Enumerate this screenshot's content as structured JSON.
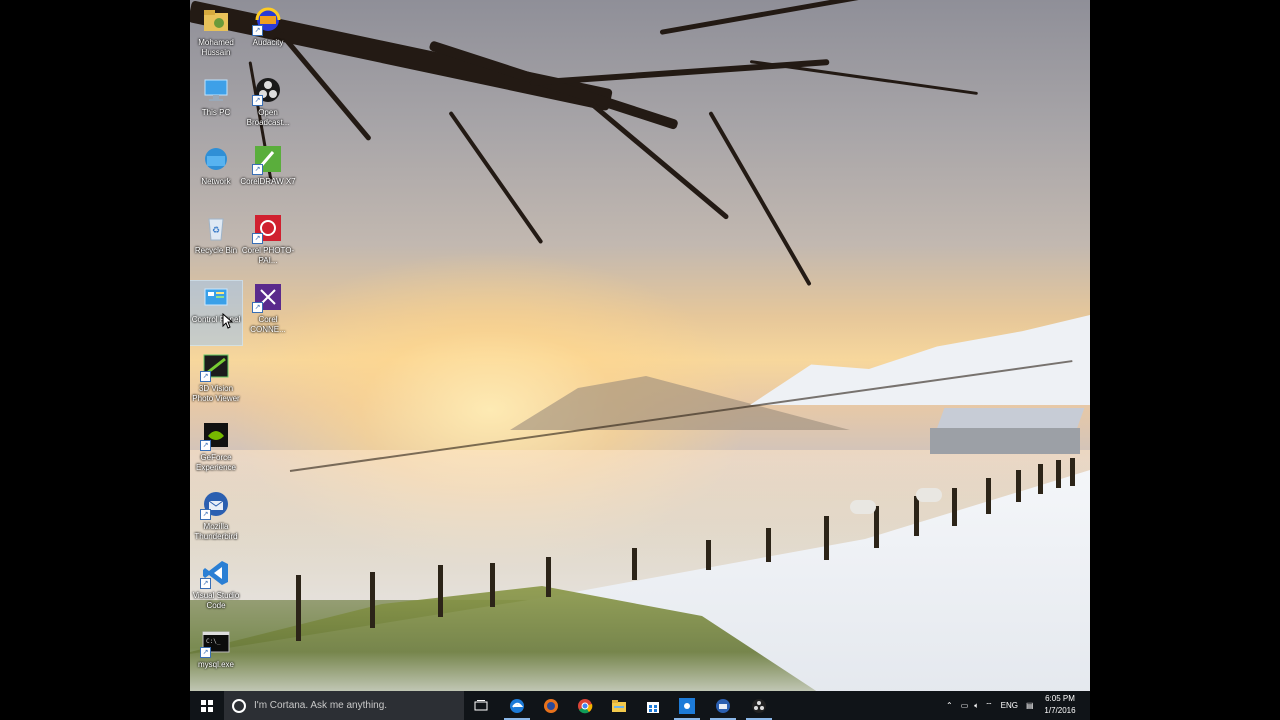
{
  "desktop": {
    "icons_col1": [
      {
        "label": "Mohamed Hussain",
        "icon": "user-folder-icon"
      },
      {
        "label": "This PC",
        "icon": "computer-icon"
      },
      {
        "label": "Network",
        "icon": "network-icon"
      },
      {
        "label": "Recycle Bin",
        "icon": "recycle-bin-icon"
      },
      {
        "label": "Control Panel",
        "icon": "control-panel-icon",
        "selected": true
      },
      {
        "label": "3D Vision Photo Viewer",
        "icon": "3d-vision-icon"
      },
      {
        "label": "GeForce Experience",
        "icon": "geforce-icon"
      },
      {
        "label": "Mozilla Thunderbird",
        "icon": "thunderbird-icon"
      },
      {
        "label": "Visual Studio Code",
        "icon": "vscode-icon"
      },
      {
        "label": "mysql.exe",
        "icon": "console-icon"
      }
    ],
    "icons_col2": [
      {
        "label": "Audacity",
        "icon": "audacity-icon"
      },
      {
        "label": "Open Broadcast...",
        "icon": "obs-icon"
      },
      {
        "label": "CorelDRAW X7",
        "icon": "coreldraw-icon"
      },
      {
        "label": "Corel PHOTO-PAI...",
        "icon": "corel-photopaint-icon"
      },
      {
        "label": "Corel CONNE...",
        "icon": "corel-connect-icon"
      }
    ]
  },
  "taskbar": {
    "cortana_placeholder": "I'm Cortana. Ask me anything.",
    "language": "ENG",
    "time": "6:05 PM",
    "date": "1/7/2016"
  },
  "colors": {
    "taskbar_bg": "#101418",
    "cortana_bg": "#2c2f34",
    "selection": "#96c8ff"
  }
}
